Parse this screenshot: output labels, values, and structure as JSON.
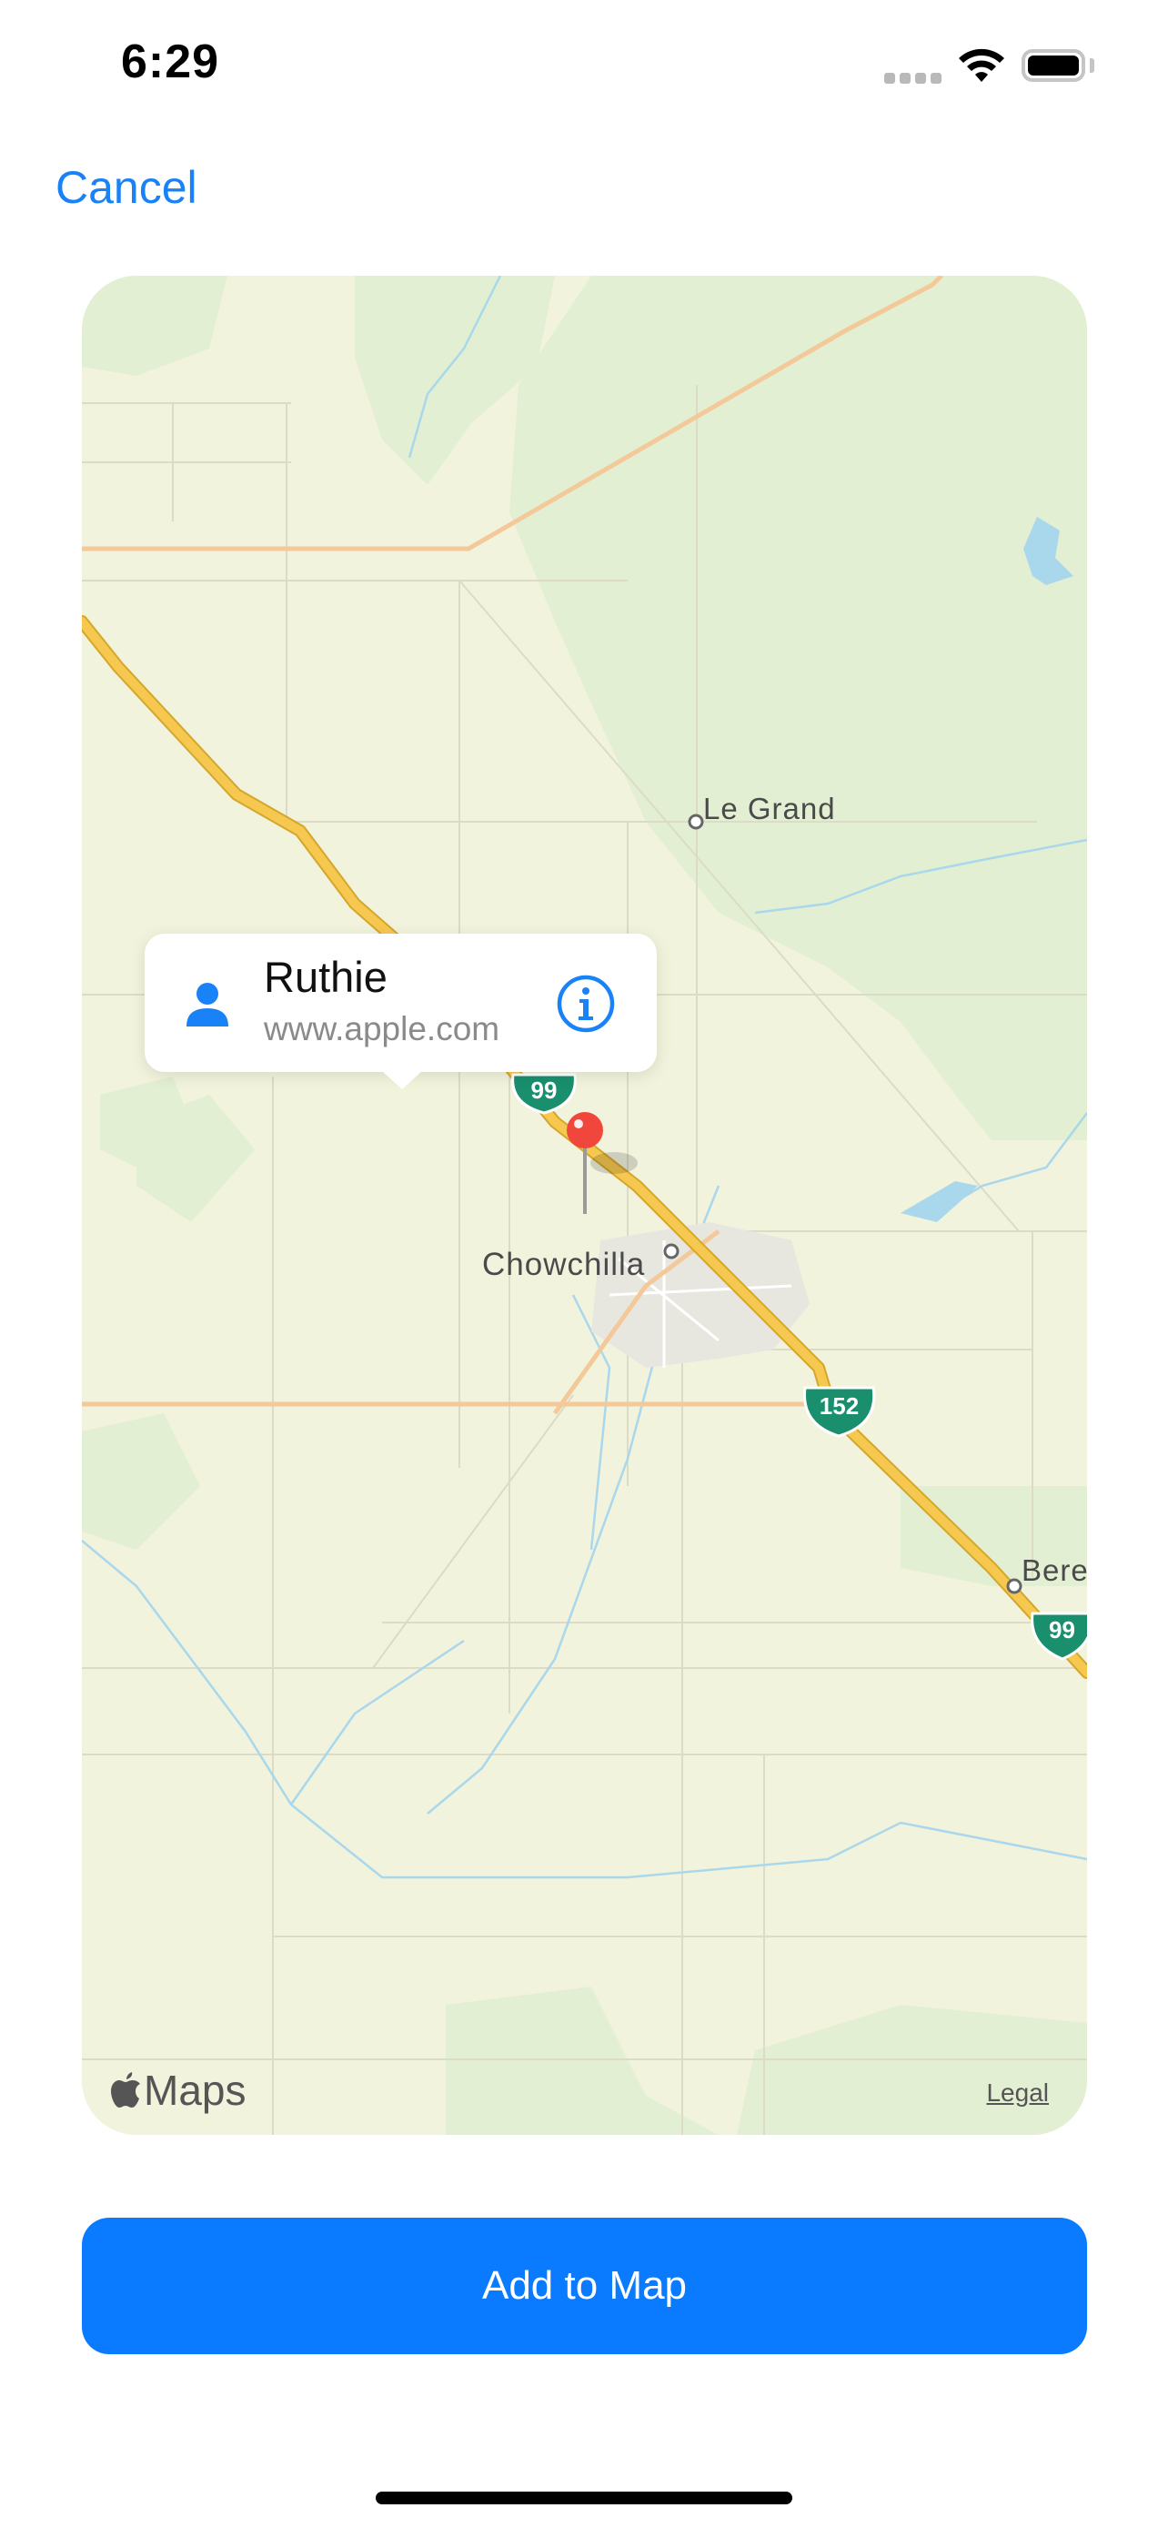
{
  "status_bar": {
    "time": "6:29"
  },
  "nav": {
    "cancel_label": "Cancel"
  },
  "map": {
    "place_labels": {
      "le_grand": "Le Grand",
      "chowchilla": "Chowchilla",
      "berenda": "Bere"
    },
    "route_shields": {
      "hwy99_north": "99",
      "hwy152": "152",
      "hwy99_south": "99"
    },
    "callout": {
      "title": "Ruthie",
      "subtitle": "www.apple.com"
    },
    "attribution": {
      "logo_text": "Maps",
      "legal_label": "Legal"
    }
  },
  "actions": {
    "add_label": "Add to Map"
  },
  "colors": {
    "accent": "#0a7aff",
    "link": "#1a82f7",
    "map_land": "#f1f3dc",
    "map_green": "#e3efd2",
    "highway": "#f6c84f",
    "pin": "#f0463c",
    "shield": "#1a8f6e"
  }
}
